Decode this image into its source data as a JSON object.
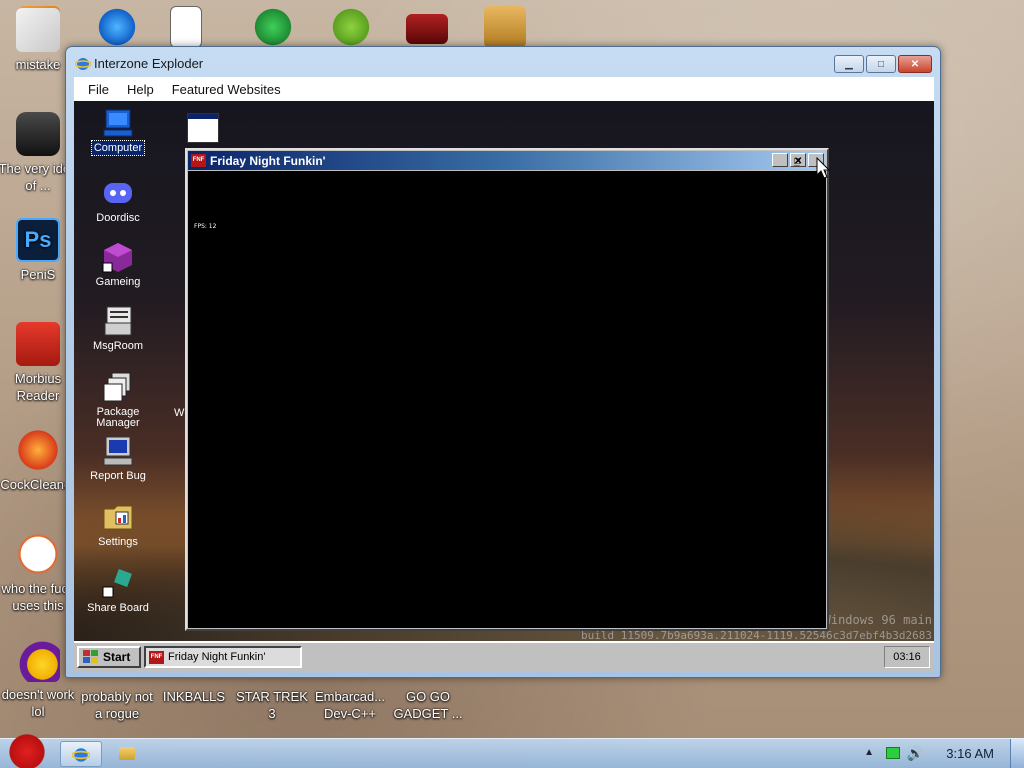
{
  "host_desktop": {
    "icons_left": [
      {
        "label": "mistake",
        "icon": "installer-icon"
      },
      {
        "label": "The very idea of ...",
        "icon": "trash-bin-icon"
      },
      {
        "label": "PeniS",
        "icon": "photoshop-icon"
      },
      {
        "label": "Morbius Reader",
        "icon": "pdf-reader-icon"
      },
      {
        "label": "CockCleaner",
        "icon": "cleaner-brush-icon"
      },
      {
        "label": "who the fuck uses this",
        "icon": "lightning-icon"
      },
      {
        "label": "doesn't work lol",
        "icon": "yahoo-messenger-icon"
      }
    ],
    "icons_bottom": [
      {
        "label": "probably not a rogue"
      },
      {
        "label": "INKBALLS"
      },
      {
        "label": "STAR TREK 3"
      },
      {
        "label": "Embarcad... Dev-C++"
      },
      {
        "label": "GO GO GADGET ..."
      }
    ]
  },
  "browser": {
    "title": "Interzone Exploder",
    "menu": [
      "File",
      "Help",
      "Featured Websites"
    ]
  },
  "w96": {
    "desktop_icons": [
      {
        "label": "Computer",
        "icon": "computer-icon",
        "selected": true
      },
      {
        "label": "Doordisc",
        "icon": "doordisc-icon"
      },
      {
        "label": "Gameing",
        "icon": "game-cube-icon"
      },
      {
        "label": "MsgRoom",
        "icon": "msgroom-icon"
      },
      {
        "label": "Package Manager",
        "icon": "package-manager-icon"
      },
      {
        "label": "Report Bug",
        "icon": "report-bug-icon"
      },
      {
        "label": "Settings",
        "icon": "settings-icon"
      },
      {
        "label": "Share Board",
        "icon": "share-board-icon"
      }
    ],
    "stray_letter": "W",
    "watermark_line1": "Windows 96 main",
    "watermark_line2": "build 11509.7b9a693a.211024-1119.52546c3d7ebf4b3d2683",
    "window": {
      "title": "Friday Night Funkin'",
      "fps_text": "FPS: 12",
      "icon_text": "FNF"
    },
    "taskbar": {
      "start_label": "Start",
      "task_label": "Friday Night Funkin'",
      "clock": "03:16"
    }
  },
  "host_taskbar": {
    "clock": "3:16 AM"
  }
}
